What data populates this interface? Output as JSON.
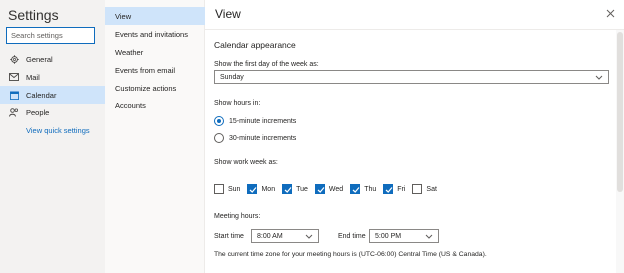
{
  "sidebar": {
    "title": "Settings",
    "search_placeholder": "Search settings",
    "items": [
      {
        "label": "General",
        "icon": "gear-icon"
      },
      {
        "label": "Mail",
        "icon": "mail-icon"
      },
      {
        "label": "Calendar",
        "icon": "calendar-icon",
        "selected": true
      },
      {
        "label": "People",
        "icon": "people-icon"
      }
    ],
    "quick_link": "View quick settings"
  },
  "subnav": {
    "items": [
      {
        "label": "View",
        "selected": true
      },
      {
        "label": "Events and invitations"
      },
      {
        "label": "Weather"
      },
      {
        "label": "Events from email"
      },
      {
        "label": "Customize actions"
      },
      {
        "label": "Accounts"
      }
    ]
  },
  "main": {
    "title": "View",
    "section_title": "Calendar appearance",
    "first_day_label": "Show the first day of the week as:",
    "first_day_value": "Sunday",
    "hours_label": "Show hours in:",
    "hours_options": [
      {
        "label": "15-minute increments",
        "checked": true
      },
      {
        "label": "30-minute increments",
        "checked": false
      }
    ],
    "work_week_label": "Show work week as:",
    "days": [
      {
        "label": "Sun",
        "checked": false
      },
      {
        "label": "Mon",
        "checked": true
      },
      {
        "label": "Tue",
        "checked": true
      },
      {
        "label": "Wed",
        "checked": true
      },
      {
        "label": "Thu",
        "checked": true
      },
      {
        "label": "Fri",
        "checked": true
      },
      {
        "label": "Sat",
        "checked": false
      }
    ],
    "meeting_hours_label": "Meeting hours:",
    "start_time_label": "Start time",
    "start_time_value": "8:00 AM",
    "end_time_label": "End time",
    "end_time_value": "5:00 PM",
    "timezone_note": "The current time zone for your meeting hours is (UTC-06:00) Central Time (US & Canada)."
  },
  "colors": {
    "accent": "#0f6cbd",
    "selected_bg": "#cfe4fa",
    "sidebar_bg": "#f3f2f1"
  }
}
